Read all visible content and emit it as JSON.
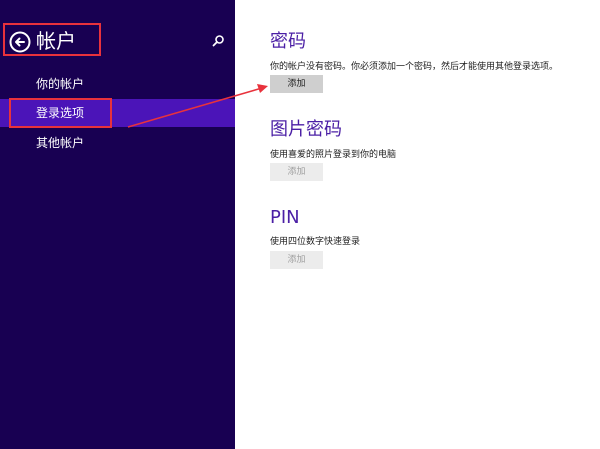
{
  "sidebar": {
    "title": "帐户",
    "items": [
      {
        "label": "你的帐户"
      },
      {
        "label": "登录选项"
      },
      {
        "label": "其他帐户"
      }
    ]
  },
  "sections": [
    {
      "title": "密码",
      "description": "你的帐户没有密码。你必须添加一个密码，然后才能使用其他登录选项。",
      "button": "添加",
      "enabled": true
    },
    {
      "title": "图片密码",
      "description": "使用喜爱的照片登录到你的电脑",
      "button": "添加",
      "enabled": false
    },
    {
      "title": "PIN",
      "description": "使用四位数字快速登录",
      "button": "添加",
      "enabled": false
    }
  ],
  "colors": {
    "sidebar_bg": "#180052",
    "selected_item": "#4b14b8",
    "heading": "#4b1fa5",
    "annotation": "#e8323c"
  }
}
